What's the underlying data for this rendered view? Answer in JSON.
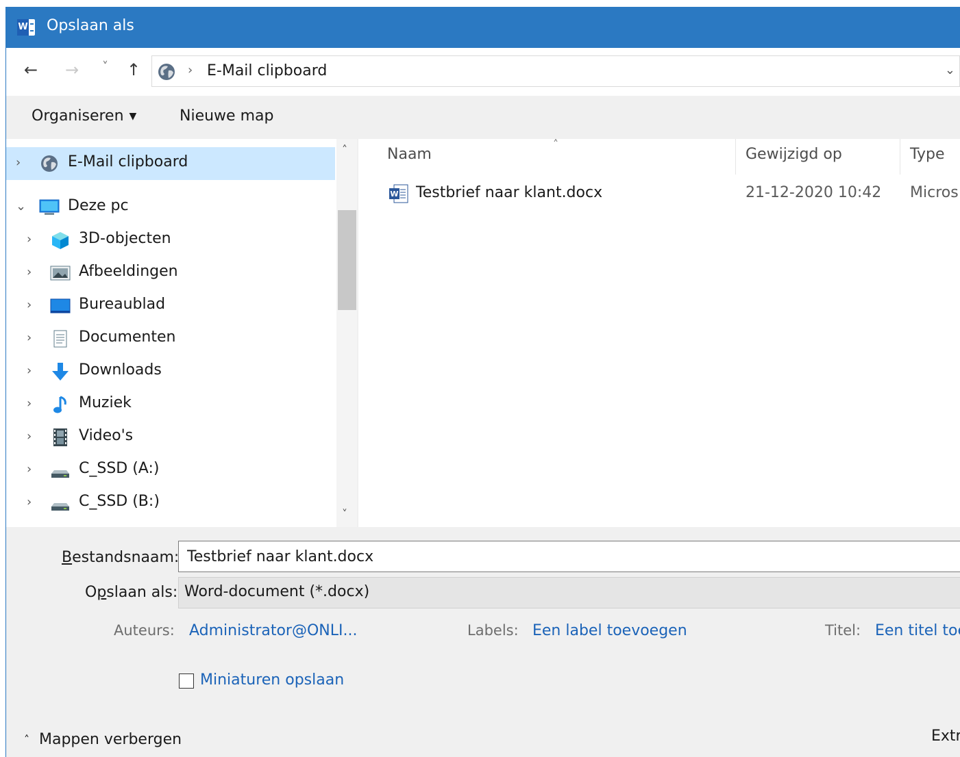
{
  "window": {
    "title": "Opslaan als",
    "app_icon_letter": "W",
    "accent": "#2b79c2"
  },
  "navigation": {
    "back_icon": "←",
    "forward_icon": "→",
    "recent_icon": "˅",
    "up_icon": "↑",
    "breadcrumb_separator": "›",
    "breadcrumb": "E-Mail clipboard",
    "dropdown_icon": "⌄"
  },
  "toolbar": {
    "organize_label": "Organiseren",
    "organize_caret": "▼",
    "new_folder_label": "Nieuwe map"
  },
  "tree": {
    "items": [
      {
        "label": "E-Mail clipboard",
        "chevron": "›",
        "icon": "globe-icon",
        "selected": true
      },
      {
        "label": "Deze pc",
        "chevron": "⌄",
        "icon": "pc-icon",
        "selected": false
      },
      {
        "label": "3D-objecten",
        "chevron": "›",
        "icon": "cube-icon"
      },
      {
        "label": "Afbeeldingen",
        "chevron": "›",
        "icon": "pictures-icon"
      },
      {
        "label": "Bureaublad",
        "chevron": "›",
        "icon": "desktop-icon"
      },
      {
        "label": "Documenten",
        "chevron": "›",
        "icon": "documents-icon"
      },
      {
        "label": "Downloads",
        "chevron": "›",
        "icon": "downloads-icon"
      },
      {
        "label": "Muziek",
        "chevron": "›",
        "icon": "music-icon"
      },
      {
        "label": "Video's",
        "chevron": "›",
        "icon": "video-icon"
      },
      {
        "label": "C_SSD (A:)",
        "chevron": "›",
        "icon": "drive-icon"
      },
      {
        "label": "C_SSD (B:)",
        "chevron": "›",
        "icon": "drive-icon"
      }
    ],
    "scroll_up": "˄",
    "scroll_down": "˅"
  },
  "files": {
    "sort_caret": "˄",
    "columns": {
      "name": "Naam",
      "modified": "Gewijzigd op",
      "type": "Type"
    },
    "rows": [
      {
        "name": "Testbrief naar klant.docx",
        "modified": "21-12-2020 10:42",
        "type": "Micros"
      }
    ]
  },
  "form": {
    "filename_label_accel": "B",
    "filename_label_rest": "estandsnaam:",
    "filename_value": "Testbrief naar klant.docx",
    "savetype_label_pre": "O",
    "savetype_label_accel": "p",
    "savetype_label_rest": "slaan als:",
    "savetype_value": "Word-document (*.docx)",
    "authors_label": "Auteurs:",
    "authors_value": "Administrator@ONLI...",
    "labels_label": "Labels:",
    "labels_value": "Een label toevoegen",
    "title_label": "Titel:",
    "title_value": "Een titel toe",
    "thumbnails_label": "Miniaturen opslaan",
    "thumbnails_checked": false
  },
  "footer": {
    "hide_folders_caret": "˄",
    "hide_folders": "Mappen verbergen",
    "extra_label": "Extr"
  }
}
